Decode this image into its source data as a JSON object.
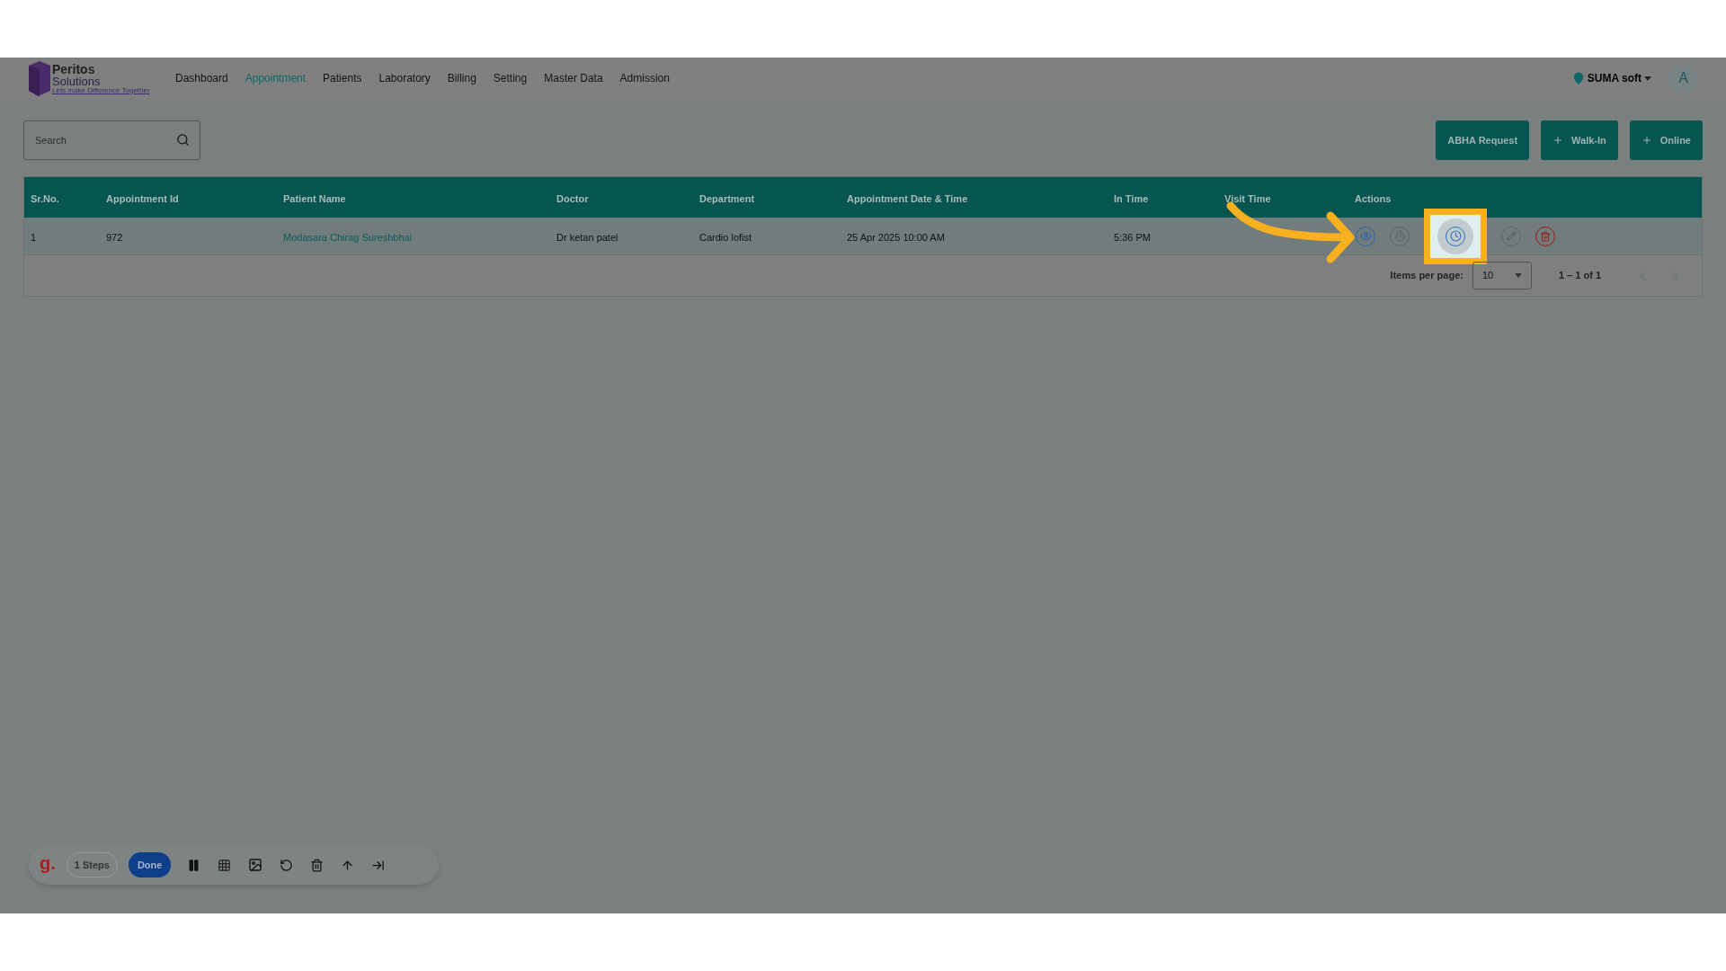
{
  "logo": {
    "name": "Peritos",
    "sub": "Solutions",
    "tagline": "Lets make Difference Together"
  },
  "nav": [
    {
      "label": "Dashboard",
      "selected": false
    },
    {
      "label": "Appointment",
      "selected": true
    },
    {
      "label": "Patients",
      "selected": false
    },
    {
      "label": "Laboratory",
      "selected": false
    },
    {
      "label": "Billing",
      "selected": false
    },
    {
      "label": "Setting",
      "selected": false
    },
    {
      "label": "Master Data",
      "selected": false
    },
    {
      "label": "Admission",
      "selected": false
    }
  ],
  "location": "SUMA soft",
  "avatar": "A",
  "search": {
    "placeholder": "Search"
  },
  "buttons": [
    {
      "label": "ABHA Request",
      "plus": false
    },
    {
      "label": "Walk-In",
      "plus": true
    },
    {
      "label": "Online",
      "plus": true
    }
  ],
  "table": {
    "columns": [
      "Sr.No.",
      "Appointment Id",
      "Patient Name",
      "Doctor",
      "Department",
      "Appointment Date & Time",
      "In Time",
      "Visit Time",
      "Actions"
    ],
    "rows": [
      {
        "sr": "1",
        "id": "972",
        "patient": "Modasara Chirag Sureshbhai",
        "doctor": "Dr ketan patel",
        "department": "Cardio lofist",
        "datetime": "25 Apr 2025 10:00 AM",
        "in_time": "5:36 PM",
        "actions": [
          {
            "kind": "view",
            "selected": false
          },
          {
            "kind": "timer",
            "selected": false
          },
          {
            "kind": "clock",
            "selected": true
          },
          {
            "kind": "edit",
            "selected": false
          },
          {
            "kind": "delete",
            "selected": false
          }
        ]
      }
    ]
  },
  "pagination": {
    "label": "Items per page:",
    "per_page": "10",
    "range": "1 – 1 of 1"
  },
  "recorder": {
    "logo": "g.",
    "steps": "1 Steps",
    "done": "Done"
  }
}
